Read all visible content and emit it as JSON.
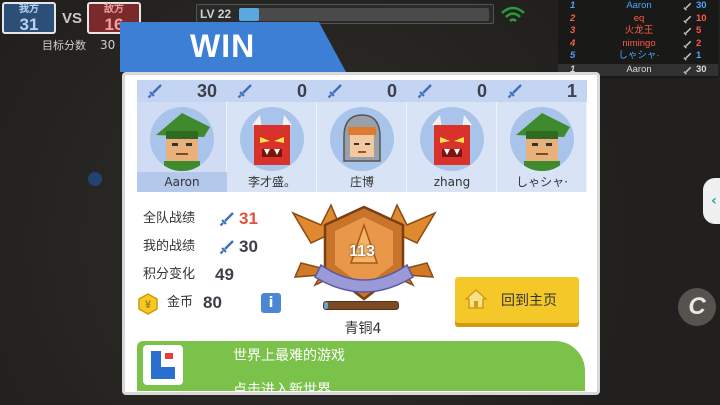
{
  "scoreboard": {
    "us_label": "我方",
    "us_score": "31",
    "vs": "VS",
    "enemy_label": "敌方",
    "enemy_score": "16",
    "target_label": "目标分数",
    "target_value": "30"
  },
  "level": {
    "label": "LV 22",
    "progress": 0.08
  },
  "leaderboard": [
    {
      "rank": "1",
      "name": "Aaron",
      "kills": "30",
      "color": "#4da3ff"
    },
    {
      "rank": "2",
      "name": "eq",
      "kills": "10",
      "color": "#ff5a4a"
    },
    {
      "rank": "3",
      "name": "火龙王",
      "kills": "5",
      "color": "#ff5a4a"
    },
    {
      "rank": "4",
      "name": "nimingo",
      "kills": "2",
      "color": "#ff5a4a"
    },
    {
      "rank": "5",
      "name": "しゃシャ·",
      "kills": "1",
      "color": "#4da3ff"
    },
    {
      "rank": "1",
      "name": "Aaron",
      "kills": "30",
      "color": "#d8d8d8"
    }
  ],
  "result": {
    "title": "WIN",
    "players": [
      {
        "name": "Aaron",
        "kills": "30",
        "avatar": "green-hood"
      },
      {
        "name": "李才盛。",
        "kills": "0",
        "avatar": "red-demon"
      },
      {
        "name": "庄博",
        "kills": "0",
        "avatar": "knight"
      },
      {
        "name": "zhang",
        "kills": "0",
        "avatar": "red-demon"
      },
      {
        "name": "しゃシャ·",
        "kills": "1",
        "avatar": "green-hood"
      }
    ],
    "stats": {
      "team_label": "全队战绩",
      "team_value": "31",
      "my_label": "我的战绩",
      "my_value": "30",
      "points_label": "积分变化",
      "points_value": "49",
      "coins_label": "金币",
      "coins_value": "80"
    },
    "rank": {
      "number": "113",
      "name": "青铜4",
      "progress": 0.06
    },
    "home_button": "回到主页",
    "banner": {
      "line1": "世界上最难的游戏",
      "line2": "点击进入新世界"
    }
  },
  "colors": {
    "accent_blue": "#3e7fd6",
    "win_red": "#e0523a",
    "button_yellow": "#f5c82a",
    "banner_green": "#7bc24a"
  }
}
